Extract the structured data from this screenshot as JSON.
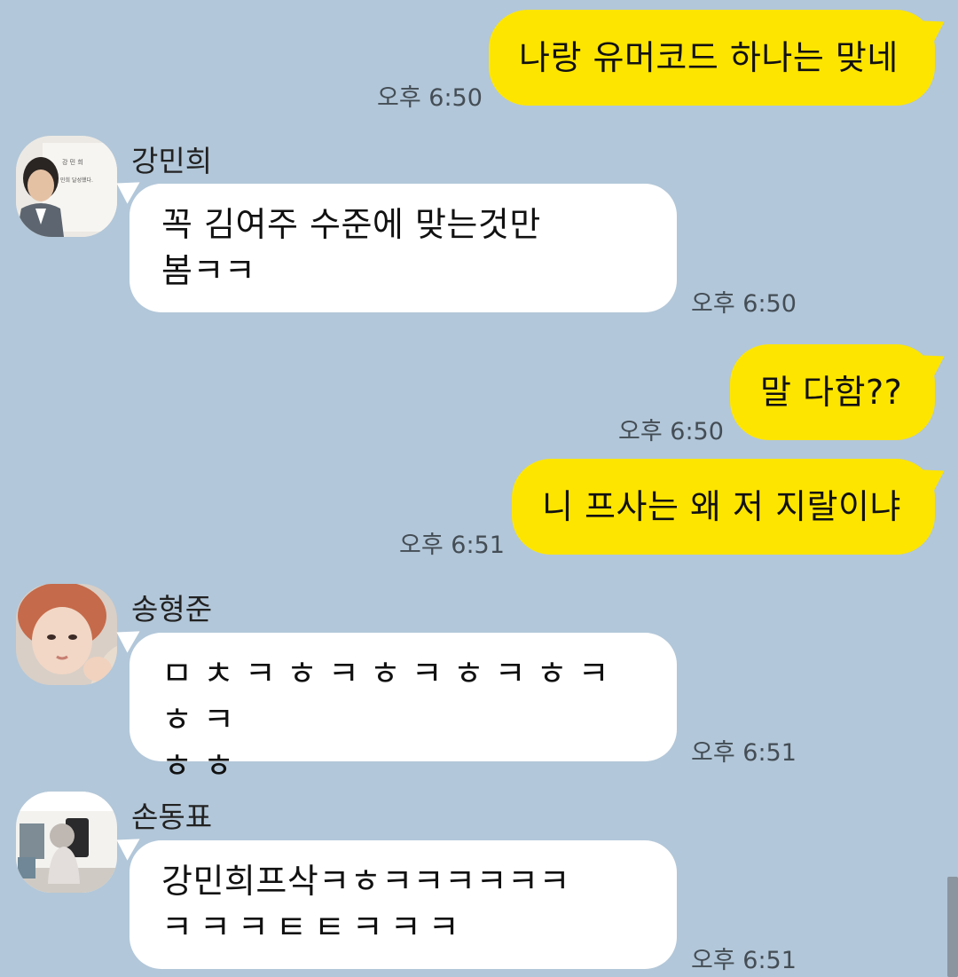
{
  "colors": {
    "background": "#b2c7d9",
    "my_bubble": "#fee500",
    "their_bubble": "#ffffff"
  },
  "messages": [
    {
      "type": "me",
      "text": "나랑 유머코드 하나는 맞네",
      "time": "오후 6:50"
    },
    {
      "type": "them",
      "sender": "강민희",
      "avatar": "avatar-photo",
      "avatar_caption": [
        "강 민 희",
        "민희 달성했다."
      ],
      "lines": [
        "꼭 김여주 수준에 맞는것만",
        "봄ㅋㅋ"
      ],
      "time": "오후 6:50"
    },
    {
      "type": "me",
      "text": "말 다함??",
      "time": "오후 6:50"
    },
    {
      "type": "me",
      "text": "니 프사는 왜 저 지랄이냐",
      "time": "오후 6:51"
    },
    {
      "type": "them",
      "sender": "송형준",
      "avatar": "avatar-photo",
      "lines": [
        "ㅁㅊㅋㅎㅋㅎㅋㅎㅋㅎㅋㅎㅋ",
        "ㅎㅎ"
      ],
      "time": "오후 6:51"
    },
    {
      "type": "them",
      "sender": "손동표",
      "avatar": "avatar-photo",
      "lines": [
        "강민희프삭ㅋㅎㅋㅋㅋㅋㅋㅋ",
        "ㅋㅋㅋㅌㅌㅋㅋㅋ"
      ],
      "time": "오후 6:51"
    }
  ]
}
